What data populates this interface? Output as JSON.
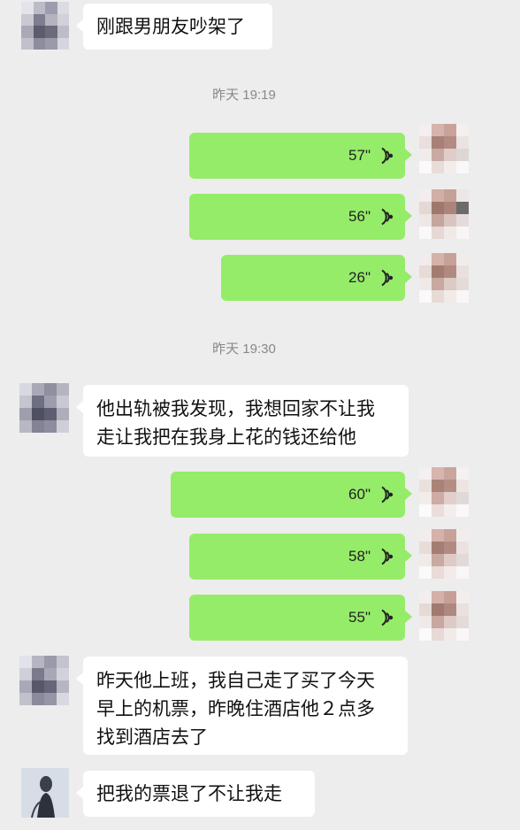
{
  "chat": {
    "messages": [
      {
        "type": "text",
        "side": "left",
        "text": "刚跟男朋友吵架了"
      },
      {
        "type": "timestamp",
        "text": "昨天 19:19"
      },
      {
        "type": "voice",
        "side": "right",
        "duration": "57\""
      },
      {
        "type": "voice",
        "side": "right",
        "duration": "56\""
      },
      {
        "type": "voice",
        "side": "right",
        "duration": "26\""
      },
      {
        "type": "timestamp",
        "text": "昨天 19:30"
      },
      {
        "type": "text",
        "side": "left",
        "text": "他出轨被我发现，我想回家不让我\n走让我把在我身上花的钱还给他"
      },
      {
        "type": "voice",
        "side": "right",
        "duration": "60\""
      },
      {
        "type": "voice",
        "side": "right",
        "duration": "58\""
      },
      {
        "type": "voice",
        "side": "right",
        "duration": "55\""
      },
      {
        "type": "text",
        "side": "left",
        "text": "昨天他上班，我自己走了买了今天\n早上的机票，昨晚住酒店他２点多\n找到酒店去了"
      },
      {
        "type": "text",
        "side": "left",
        "text": "把我的票退了不让我走"
      }
    ]
  },
  "colors": {
    "background": "#ededed",
    "sent_bubble": "#95ec69",
    "received_bubble": "#ffffff",
    "timestamp_text": "#888888"
  },
  "icons": {
    "voice": "voice-wave-icon",
    "avatar": "pixelated-avatar"
  }
}
